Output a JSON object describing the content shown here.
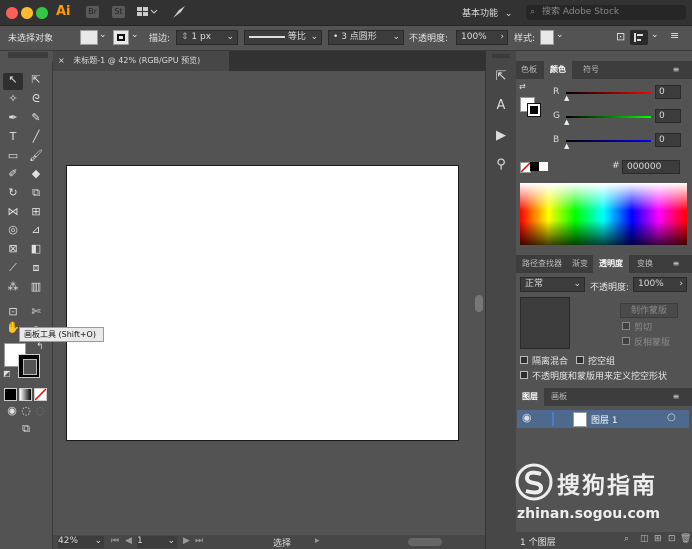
{
  "app": {
    "logo": "Ai",
    "br_label": "Br",
    "st_label": "St"
  },
  "titlebar": {
    "workspace": "基本功能",
    "search_placeholder": "搜索 Adobe Stock"
  },
  "control_bar": {
    "no_selection": "未选择对象",
    "stroke_label": "描边:",
    "stroke_weight": "1 px",
    "profile": "等比",
    "brush": "3 点圆形",
    "opacity_label": "不透明度:",
    "opacity_value": "100%",
    "style_label": "样式:"
  },
  "document": {
    "tab_title": "未标题-1 @ 42% (RGB/GPU 预览)",
    "zoom": "42%",
    "artboard_number": "1",
    "status_text": "选择"
  },
  "tooltip": {
    "text": "画板工具 (Shift+O)"
  },
  "color_panel": {
    "tabs": [
      "色板",
      "颜色",
      "符号"
    ],
    "active_tab": "颜色",
    "r_label": "R",
    "g_label": "G",
    "b_label": "B",
    "r_value": "0",
    "g_value": "0",
    "b_value": "0",
    "hash": "#",
    "hex": "000000"
  },
  "transparency_panel": {
    "tabs": [
      "路径查找器",
      "渐变",
      "透明度",
      "变换"
    ],
    "active_tab": "透明度",
    "blend_mode": "正常",
    "opacity_label": "不透明度:",
    "opacity_value": "100%",
    "make_mask": "制作蒙版",
    "clip": "剪切",
    "invert": "反相蒙版",
    "isolate": "隔离混合",
    "knockout": "挖空组",
    "opacity_mask_define": "不透明度和蒙版用来定义挖空形状"
  },
  "layers_panel": {
    "tabs": [
      "图层",
      "画板"
    ],
    "active_tab": "图层",
    "layer_name": "图层 1",
    "footer_count": "1 个图层"
  },
  "watermark": {
    "line1": "搜狗指南",
    "line2": "zhinan.sogou.com"
  },
  "colors": {
    "accent_blue": "#4a7bd6",
    "layer_row": "#4d6a8e",
    "app_orange": "#ff9a00",
    "traffic_red": "#fc5f57",
    "traffic_yellow": "#fdbc2e",
    "traffic_green": "#33c748"
  }
}
